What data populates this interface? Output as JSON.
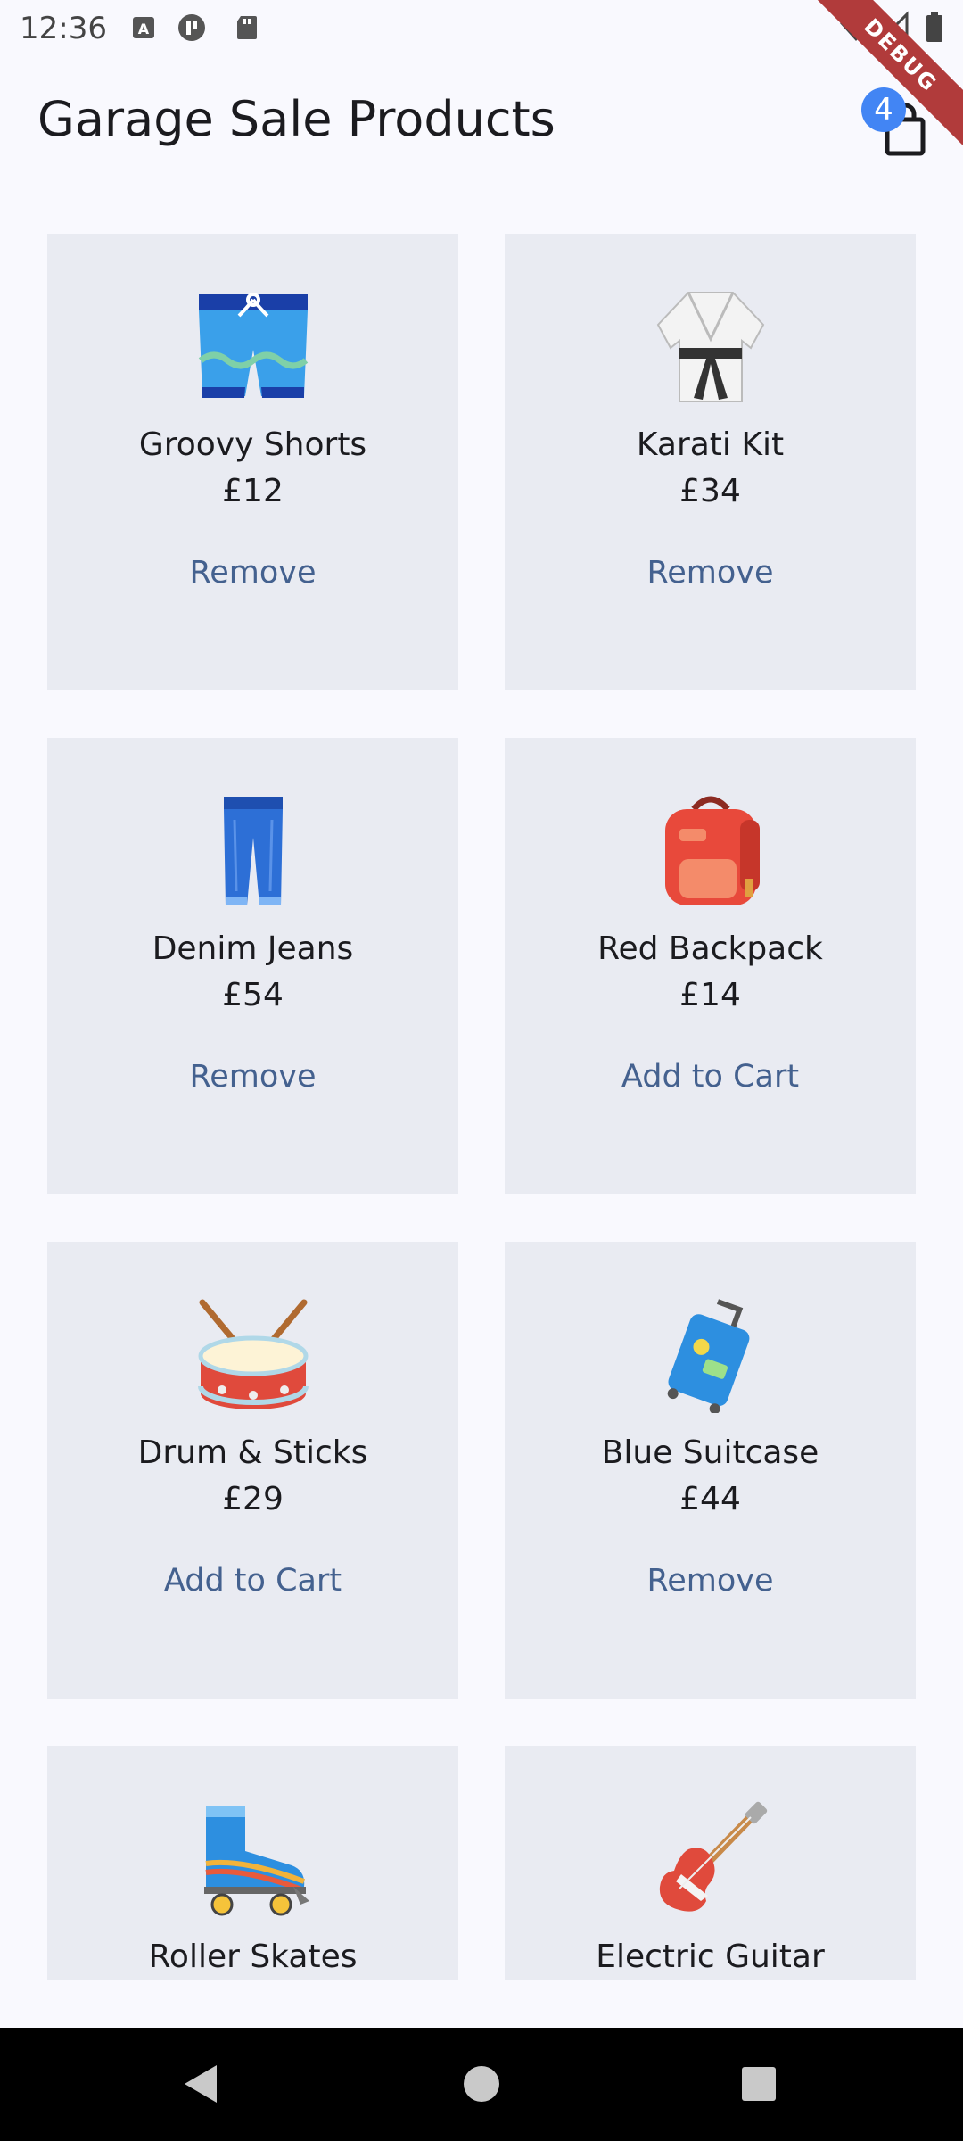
{
  "status_bar": {
    "time": "12:36"
  },
  "debug_banner": "DEBUG",
  "app_bar": {
    "title": "Garage Sale Products",
    "cart_count": "4"
  },
  "products": [
    {
      "name": "Groovy Shorts",
      "price": "£12",
      "action": "Remove",
      "icon": "shorts-icon"
    },
    {
      "name": "Karati Kit",
      "price": "£34",
      "action": "Remove",
      "icon": "martial-arts-uniform-icon"
    },
    {
      "name": "Denim Jeans",
      "price": "£54",
      "action": "Remove",
      "icon": "jeans-icon"
    },
    {
      "name": "Red Backpack",
      "price": "£14",
      "action": "Add to Cart",
      "icon": "backpack-icon"
    },
    {
      "name": "Drum & Sticks",
      "price": "£29",
      "action": "Add to Cart",
      "icon": "drum-icon"
    },
    {
      "name": "Blue Suitcase",
      "price": "£44",
      "action": "Remove",
      "icon": "suitcase-icon"
    },
    {
      "name": "Roller Skates",
      "icon": "roller-skate-icon"
    },
    {
      "name": "Electric Guitar",
      "icon": "guitar-icon"
    }
  ],
  "colors": {
    "background": "#f9f9fe",
    "card": "#e9ebf2",
    "action_text": "#44618f",
    "badge": "#4285f4",
    "debug_banner": "#b13b3b"
  }
}
